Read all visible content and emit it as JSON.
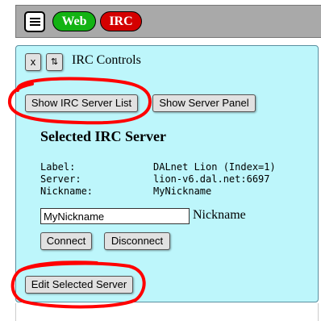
{
  "nav": {
    "web_label": "Web",
    "irc_label": "IRC",
    "web_color": "#13b313",
    "irc_color": "#d40000"
  },
  "panel": {
    "close_label": "x",
    "collapse_label": "⇅",
    "title": "IRC Controls",
    "show_list_label": "Show IRC Server List",
    "show_panel_label": "Show Server Panel",
    "heading": "Selected IRC Server",
    "details": [
      {
        "key": "Label:",
        "value": "DALnet Lion (Index=1)"
      },
      {
        "key": "Server:",
        "value": "lion-v6.dal.net:6697"
      },
      {
        "key": "Nickname:",
        "value": "MyNickname"
      }
    ],
    "nickname_value": "MyNickname",
    "nickname_label": "Nickname",
    "connect_label": "Connect",
    "disconnect_label": "Disconnect",
    "edit_label": "Edit Selected Server",
    "background_color": "#bdf6fb"
  },
  "annotation_color": "#ff0000"
}
